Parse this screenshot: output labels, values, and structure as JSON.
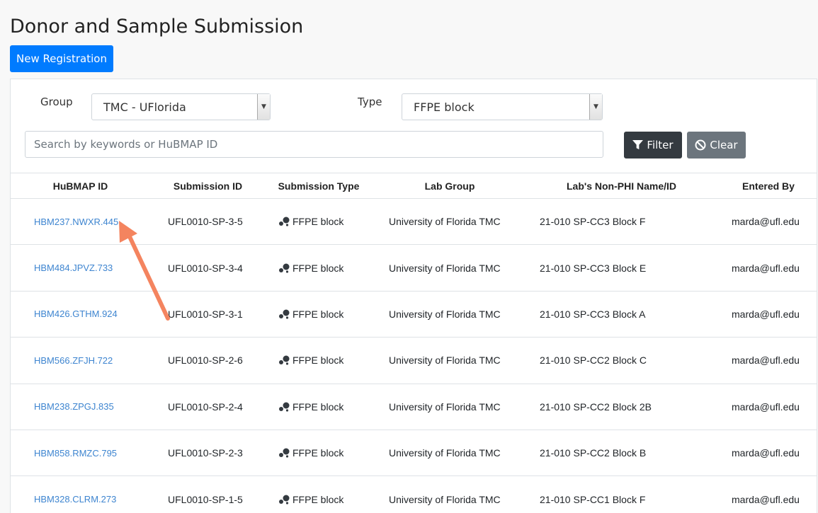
{
  "page": {
    "title": "Donor and Sample Submission"
  },
  "actions": {
    "new_registration": "New Registration"
  },
  "filters": {
    "group_label": "Group",
    "group_value": "TMC - UFlorida",
    "type_label": "Type",
    "type_value": "FFPE block",
    "search_placeholder": "Search by keywords or HuBMAP ID",
    "search_value": "",
    "filter_button": "Filter",
    "clear_button": "Clear"
  },
  "table": {
    "headers": [
      "HuBMAP ID",
      "Submission ID",
      "Submission Type",
      "Lab Group",
      "Lab's Non-PHI Name/ID",
      "Entered By"
    ],
    "rows": [
      {
        "hubmap_id": "HBM237.NWXR.445",
        "submission_id": "UFL0010-SP-3-5",
        "type": "FFPE block",
        "lab_group": "University of Florida TMC",
        "lab_name": "21-010 SP-CC3 Block F",
        "entered_by": "marda@ufl.edu"
      },
      {
        "hubmap_id": "HBM484.JPVZ.733",
        "submission_id": "UFL0010-SP-3-4",
        "type": "FFPE block",
        "lab_group": "University of Florida TMC",
        "lab_name": "21-010 SP-CC3 Block E",
        "entered_by": "marda@ufl.edu"
      },
      {
        "hubmap_id": "HBM426.GTHM.924",
        "submission_id": "UFL0010-SP-3-1",
        "type": "FFPE block",
        "lab_group": "University of Florida TMC",
        "lab_name": "21-010 SP-CC3 Block A",
        "entered_by": "marda@ufl.edu"
      },
      {
        "hubmap_id": "HBM566.ZFJH.722",
        "submission_id": "UFL0010-SP-2-6",
        "type": "FFPE block",
        "lab_group": "University of Florida TMC",
        "lab_name": "21-010 SP-CC2 Block C",
        "entered_by": "marda@ufl.edu"
      },
      {
        "hubmap_id": "HBM238.ZPGJ.835",
        "submission_id": "UFL0010-SP-2-4",
        "type": "FFPE block",
        "lab_group": "University of Florida TMC",
        "lab_name": "21-010 SP-CC2 Block 2B",
        "entered_by": "marda@ufl.edu"
      },
      {
        "hubmap_id": "HBM858.RMZC.795",
        "submission_id": "UFL0010-SP-2-3",
        "type": "FFPE block",
        "lab_group": "University of Florida TMC",
        "lab_name": "21-010 SP-CC2 Block B",
        "entered_by": "marda@ufl.edu"
      },
      {
        "hubmap_id": "HBM328.CLRM.273",
        "submission_id": "UFL0010-SP-1-5",
        "type": "FFPE block",
        "lab_group": "University of Florida TMC",
        "lab_name": "21-010 SP-CC1 Block F",
        "entered_by": "marda@ufl.edu"
      }
    ]
  },
  "icons": {
    "type_icon": "sample-dots-icon",
    "filter_icon": "funnel-icon",
    "clear_icon": "ban-icon"
  },
  "colors": {
    "primary": "#007bff",
    "dark": "#343a40",
    "secondary": "#6c757d",
    "link": "#3e85d0",
    "annotation_arrow": "#f4845f"
  }
}
